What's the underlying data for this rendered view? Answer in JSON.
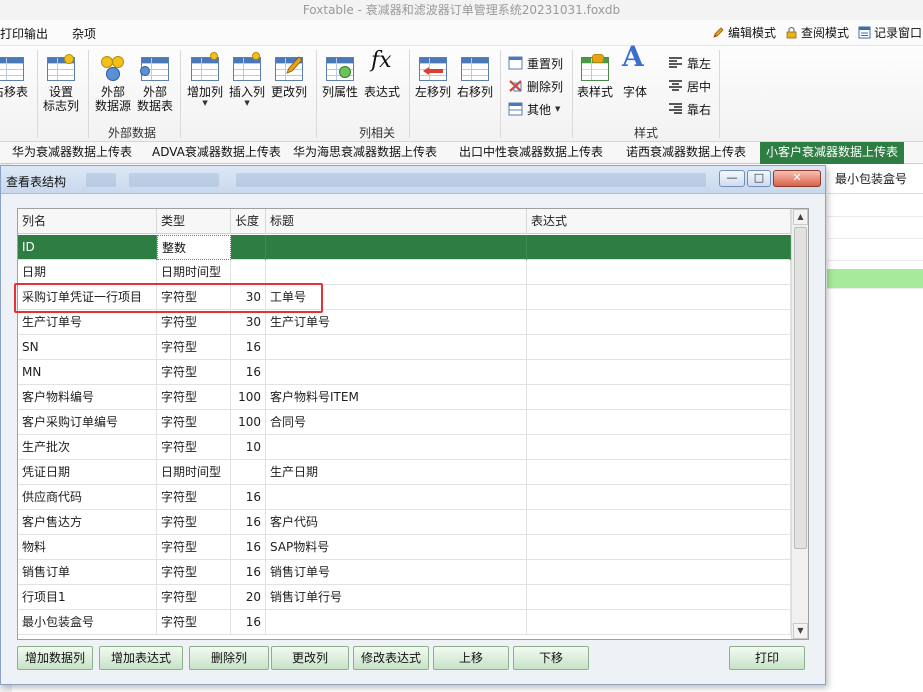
{
  "window": {
    "title": "Foxtable - 衰减器和滤波器订单管理系统20231031.foxdb"
  },
  "menubar": {
    "items": [
      "打印输出",
      "杂项"
    ],
    "modes": [
      {
        "label": "编辑模式",
        "icon": "pencil-icon"
      },
      {
        "label": "查阅模式",
        "icon": "lock-icon"
      },
      {
        "label": "记录窗口",
        "icon": "window-icon"
      }
    ]
  },
  "ribbon": {
    "buttons": {
      "move_right": "右移表",
      "set_flag": "设置\n标志列",
      "ext_source": "外部\n数据源",
      "ext_table": "外部\n数据表",
      "add_col": "增加列",
      "insert_col": "插入列",
      "modify_col": "更改列",
      "col_props": "列属性",
      "expression": "表达式",
      "move_left": "左移列",
      "move_right_col": "右移列",
      "table_style": "表样式",
      "font": "字体"
    },
    "small_buttons": {
      "reset_col": "重置列",
      "delete_col": "删除列",
      "other": "其他",
      "align_left": "靠左",
      "align_center": "居中",
      "align_right": "靠右"
    },
    "groups": {
      "external_data": "外部数据",
      "column_related": "列相关",
      "style": "样式"
    }
  },
  "tabs": {
    "items": [
      "华为衰减器数据上传表",
      "ADVA衰减器数据上传表",
      "华为海思衰减器数据上传表",
      "出口中性衰减器数据上传表",
      "诺西衰减器数据上传表",
      "小客户衰减器数据上传表"
    ],
    "active_index": 5
  },
  "background_table": {
    "visible_header": "最小包装盒号"
  },
  "dialog": {
    "title": "查看表结构",
    "window_controls": {
      "minimize": "—",
      "maximize": "□",
      "close": "✕"
    },
    "columns": [
      "列名",
      "类型",
      "长度",
      "标题",
      "表达式"
    ],
    "rows": [
      {
        "name": "ID",
        "type": "整数",
        "length": "",
        "caption": "",
        "expression": ""
      },
      {
        "name": "日期",
        "type": "日期时间型",
        "length": "",
        "caption": "",
        "expression": ""
      },
      {
        "name": "采购订单凭证一行项目",
        "type": "字符型",
        "length": "30",
        "caption": "工单号",
        "expression": ""
      },
      {
        "name": "生产订单号",
        "type": "字符型",
        "length": "30",
        "caption": "生产订单号",
        "expression": ""
      },
      {
        "name": "SN",
        "type": "字符型",
        "length": "16",
        "caption": "",
        "expression": ""
      },
      {
        "name": "MN",
        "type": "字符型",
        "length": "16",
        "caption": "",
        "expression": ""
      },
      {
        "name": "客户物料编号",
        "type": "字符型",
        "length": "100",
        "caption": "客户物料号ITEM",
        "expression": ""
      },
      {
        "name": "客户采购订单编号",
        "type": "字符型",
        "length": "100",
        "caption": "合同号",
        "expression": ""
      },
      {
        "name": "生产批次",
        "type": "字符型",
        "length": "10",
        "caption": "",
        "expression": ""
      },
      {
        "name": "凭证日期",
        "type": "日期时间型",
        "length": "",
        "caption": "生产日期",
        "expression": ""
      },
      {
        "name": "供应商代码",
        "type": "字符型",
        "length": "16",
        "caption": "",
        "expression": ""
      },
      {
        "name": "客户售达方",
        "type": "字符型",
        "length": "16",
        "caption": "客户代码",
        "expression": ""
      },
      {
        "name": "物料",
        "type": "字符型",
        "length": "16",
        "caption": "SAP物料号",
        "expression": ""
      },
      {
        "name": "销售订单",
        "type": "字符型",
        "length": "16",
        "caption": "销售订单号",
        "expression": ""
      },
      {
        "name": "行项目1",
        "type": "字符型",
        "length": "20",
        "caption": "销售订单行号",
        "expression": ""
      },
      {
        "name": "最小包装盒号",
        "type": "字符型",
        "length": "16",
        "caption": "",
        "expression": ""
      }
    ],
    "selected_row": 0,
    "highlighted_row": 2,
    "buttons": [
      "增加数据列",
      "增加表达式",
      "删除列",
      "更改列",
      "修改表达式",
      "上移",
      "下移",
      "打印"
    ]
  },
  "colors": {
    "selected_row": "#2e7d43",
    "active_tab": "#2e7d43",
    "highlight_box": "#e0343a",
    "background_green_row": "#a8ea9c",
    "button_green": "#c6e2c6"
  }
}
